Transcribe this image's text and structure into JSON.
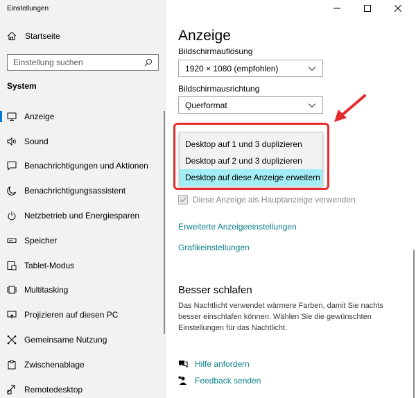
{
  "window": {
    "title": "Einstellungen",
    "minimize": "—",
    "maximize": "☐",
    "close": "✕"
  },
  "sidebar": {
    "home_label": "Startseite",
    "search_placeholder": "Einstellung suchen",
    "section": "System",
    "items": [
      {
        "label": "Anzeige",
        "icon": "display-icon",
        "active": true
      },
      {
        "label": "Sound",
        "icon": "sound-icon"
      },
      {
        "label": "Benachrichtigungen und Aktionen",
        "icon": "notification-icon"
      },
      {
        "label": "Benachrichtigungsassistent",
        "icon": "moon-icon"
      },
      {
        "label": "Netzbetrieb und Energiesparen",
        "icon": "power-icon"
      },
      {
        "label": "Speicher",
        "icon": "storage-icon"
      },
      {
        "label": "Tablet-Modus",
        "icon": "tablet-icon"
      },
      {
        "label": "Multitasking",
        "icon": "multitasking-icon"
      },
      {
        "label": "Projizieren auf diesen PC",
        "icon": "project-icon"
      },
      {
        "label": "Gemeinsame Nutzung",
        "icon": "share-icon"
      },
      {
        "label": "Zwischenablage",
        "icon": "clipboard-icon"
      },
      {
        "label": "Remotedesktop",
        "icon": "remote-icon"
      }
    ]
  },
  "main": {
    "title": "Anzeige",
    "resolution_label": "Bildschirmauflösung",
    "resolution_value": "1920 × 1080 (empfohlen)",
    "orientation_label": "Bildschirmausrichtung",
    "orientation_value": "Querformat",
    "multi_display_options": [
      "Desktop auf 1 und 3 duplizieren",
      "Desktop auf 2 und 3 duplizieren",
      "Desktop auf diese Anzeige erweitern"
    ],
    "selected_option_index": 2,
    "main_display_checkbox": "Diese Anzeige als Hauptanzeige verwenden",
    "main_display_checked": true,
    "advanced_link": "Erweiterte Anzeigeeinstellungen",
    "graphics_link": "Grafikeinstellungen",
    "sleep_heading": "Besser schlafen",
    "sleep_text": "Das Nachtlicht verwendet wärmere Farben, damit Sie nachts besser einschlafen können. Wählen Sie die gewünschten Einstellungen für das Nachtlicht.",
    "help_label": "Hilfe anfordern",
    "feedback_label": "Feedback senden"
  },
  "colors": {
    "accent": "#0078d7",
    "link": "#0a7f8a",
    "highlight": "#a3edf5",
    "annotation": "#e52b2b"
  }
}
